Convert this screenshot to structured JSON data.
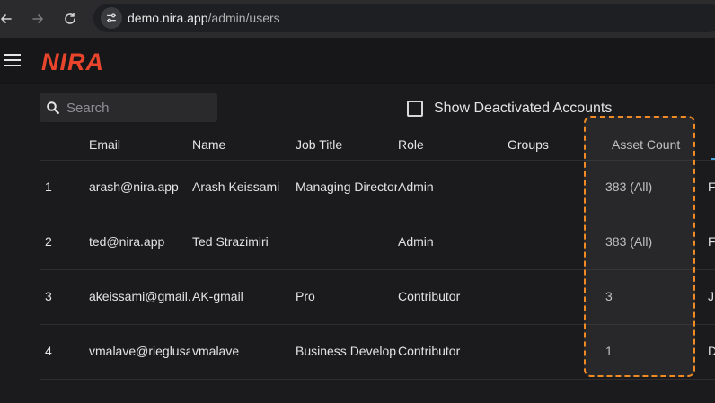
{
  "browser": {
    "url_host": "demo.nira.app",
    "url_path": "/admin/users"
  },
  "header": {
    "logo_text": "NIRA"
  },
  "toolbar": {
    "search_placeholder": "Search",
    "show_deactivated_label": "Show Deactivated Accounts",
    "show_deactivated_checked": false
  },
  "table": {
    "columns": [
      "",
      "Email",
      "Name",
      "Job Title",
      "Role",
      "Groups",
      "Asset Count"
    ],
    "rows": [
      {
        "idx": "1",
        "email": "arash@nira.app",
        "name": "Arash Keissami",
        "job": "Managing Director",
        "role": "Admin",
        "groups": "",
        "asset": "383 (All)",
        "next": "F"
      },
      {
        "idx": "2",
        "email": "ted@nira.app",
        "name": "Ted Strazimiri",
        "job": "",
        "role": "Admin",
        "groups": "",
        "asset": "383 (All)",
        "next": "F"
      },
      {
        "idx": "3",
        "email": "akeissami@gmail.com",
        "name": "AK-gmail",
        "job": "Pro",
        "role": "Contributor",
        "groups": "",
        "asset": "3",
        "next": "J"
      },
      {
        "idx": "4",
        "email": "vmalave@rieglusa.com",
        "name": "vmalave",
        "job": "Business Development",
        "role": "Contributor",
        "groups": "",
        "asset": "1",
        "next": "D"
      }
    ]
  },
  "colors": {
    "accent_orange": "#f08a24",
    "logo_red": "#e8452c",
    "sort_indicator": "#4aa3df"
  }
}
